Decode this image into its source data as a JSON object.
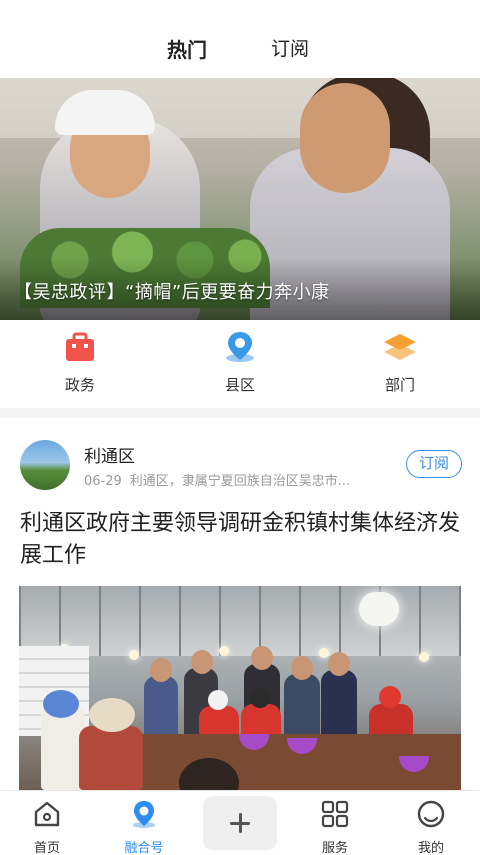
{
  "header": {
    "tabs": [
      {
        "label": "热门",
        "active": true
      },
      {
        "label": "订阅",
        "active": false
      }
    ]
  },
  "banner": {
    "caption": "【吴忠政评】“摘帽”后更要奋力奔小康"
  },
  "shortcuts": [
    {
      "label": "政务",
      "icon": "briefcase-icon",
      "color": "#f0534a"
    },
    {
      "label": "县区",
      "icon": "location-pin-icon",
      "color": "#3a9ae8"
    },
    {
      "label": "部门",
      "icon": "layers-icon",
      "color": "#f5a033"
    }
  ],
  "feed": {
    "card": {
      "author": "利通区",
      "date": "06-29",
      "description": "利通区，隶属宁夏回族自治区吴忠市...",
      "subscribe_label": "订阅",
      "headline": "利通区政府主要领导调研金积镇村集体经济发展工作"
    }
  },
  "tabbar": {
    "items": [
      {
        "label": "首页",
        "icon": "home-icon",
        "active": false
      },
      {
        "label": "融合号",
        "icon": "location-pin-icon",
        "active": true
      },
      {
        "label": "",
        "icon": "plus-icon",
        "active": false
      },
      {
        "label": "服务",
        "icon": "grid-icon",
        "active": false
      },
      {
        "label": "我的",
        "icon": "profile-icon",
        "active": false
      }
    ]
  },
  "colors": {
    "accent": "#2e8ef0",
    "subscribe": "#3a8ee6"
  }
}
